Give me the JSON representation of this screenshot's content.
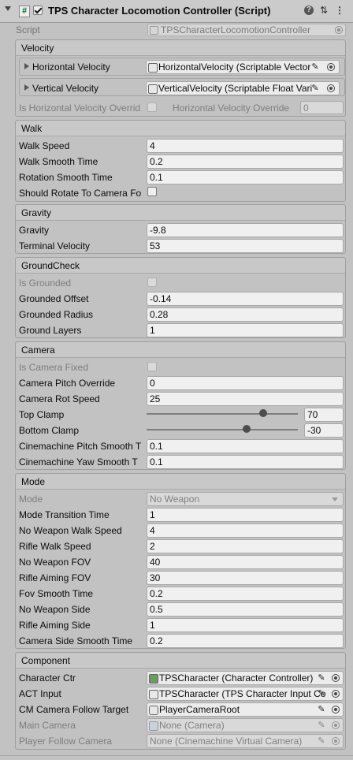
{
  "header": {
    "title": "TPS Character Locomotion Controller (Script)",
    "enabled": true,
    "icons": [
      "hash-script-icon",
      "help-icon",
      "preset-icon",
      "more-menu-icon"
    ]
  },
  "script": {
    "label": "Script",
    "value": "TPSCharacterLocomotionController"
  },
  "sections": {
    "velocity": {
      "title": "Velocity",
      "horizontal_label": "Horizontal Velocity",
      "horizontal_value": "HorizontalVelocity (Scriptable Vector",
      "vertical_label": "Vertical Velocity",
      "vertical_value": "VerticalVelocity (Scriptable Float Vari",
      "override_cb_label": "Is Horizontal Velocity Overrid",
      "override_label": "Horizontal Velocity Override",
      "override_value": "0"
    },
    "walk": {
      "title": "Walk",
      "rows": [
        {
          "label": "Walk Speed",
          "value": "4"
        },
        {
          "label": "Walk Smooth Time",
          "value": "0.2"
        },
        {
          "label": "Rotation Smooth Time",
          "value": "0.1"
        }
      ],
      "rotate_label": "Should Rotate To Camera Fo"
    },
    "gravity": {
      "title": "Gravity",
      "rows": [
        {
          "label": "Gravity",
          "value": "-9.8"
        },
        {
          "label": "Terminal Velocity",
          "value": "53"
        }
      ]
    },
    "ground": {
      "title": "GroundCheck",
      "grounded_label": "Is Grounded",
      "rows": [
        {
          "label": "Grounded Offset",
          "value": "-0.14"
        },
        {
          "label": "Grounded Radius",
          "value": "0.28"
        },
        {
          "label": "Ground Layers",
          "value": "1"
        }
      ]
    },
    "camera": {
      "title": "Camera",
      "fixed_label": "Is Camera Fixed",
      "pitch_label": "Camera Pitch Override",
      "pitch_value": "0",
      "rot_label": "Camera Rot Speed",
      "rot_value": "25",
      "top_label": "Top Clamp",
      "top_value": "70",
      "top_slider_fraction": 0.77,
      "bottom_label": "Bottom Clamp",
      "bottom_value": "-30",
      "bottom_slider_fraction": 0.66,
      "cm_pitch_label": "Cinemachine Pitch Smooth T",
      "cm_pitch_value": "0.1",
      "cm_yaw_label": "Cinemachine Yaw Smooth T",
      "cm_yaw_value": "0.1"
    },
    "mode": {
      "title": "Mode",
      "mode_label": "Mode",
      "mode_value": "No Weapon",
      "rows": [
        {
          "label": "Mode Transition Time",
          "value": "1"
        },
        {
          "label": "No Weapon Walk Speed",
          "value": "4"
        },
        {
          "label": "Rifle Walk Speed",
          "value": "2"
        },
        {
          "label": "No Weapon FOV",
          "value": "40"
        },
        {
          "label": "Rifle Aiming FOV",
          "value": "30"
        },
        {
          "label": "Fov Smooth Time",
          "value": "0.2"
        },
        {
          "label": "No Weapon Side",
          "value": "0.5"
        },
        {
          "label": "Rifle Aiming Side",
          "value": "1"
        },
        {
          "label": "Camera Side Smooth Time",
          "value": "0.2"
        }
      ]
    },
    "component": {
      "title": "Component",
      "char_label": "Character Ctr",
      "char_value": "TPSCharacter (Character Controller)",
      "act_label": "ACT Input",
      "act_value": "TPSCharacter (TPS Character Input Co",
      "cm_label": "CM Camera Follow Target",
      "cm_value": "PlayerCameraRoot",
      "main_label": "Main Camera",
      "main_value": "None (Camera)",
      "follow_label": "Player Follow Camera",
      "follow_value": "None (Cinemachine Virtual Camera)"
    }
  }
}
